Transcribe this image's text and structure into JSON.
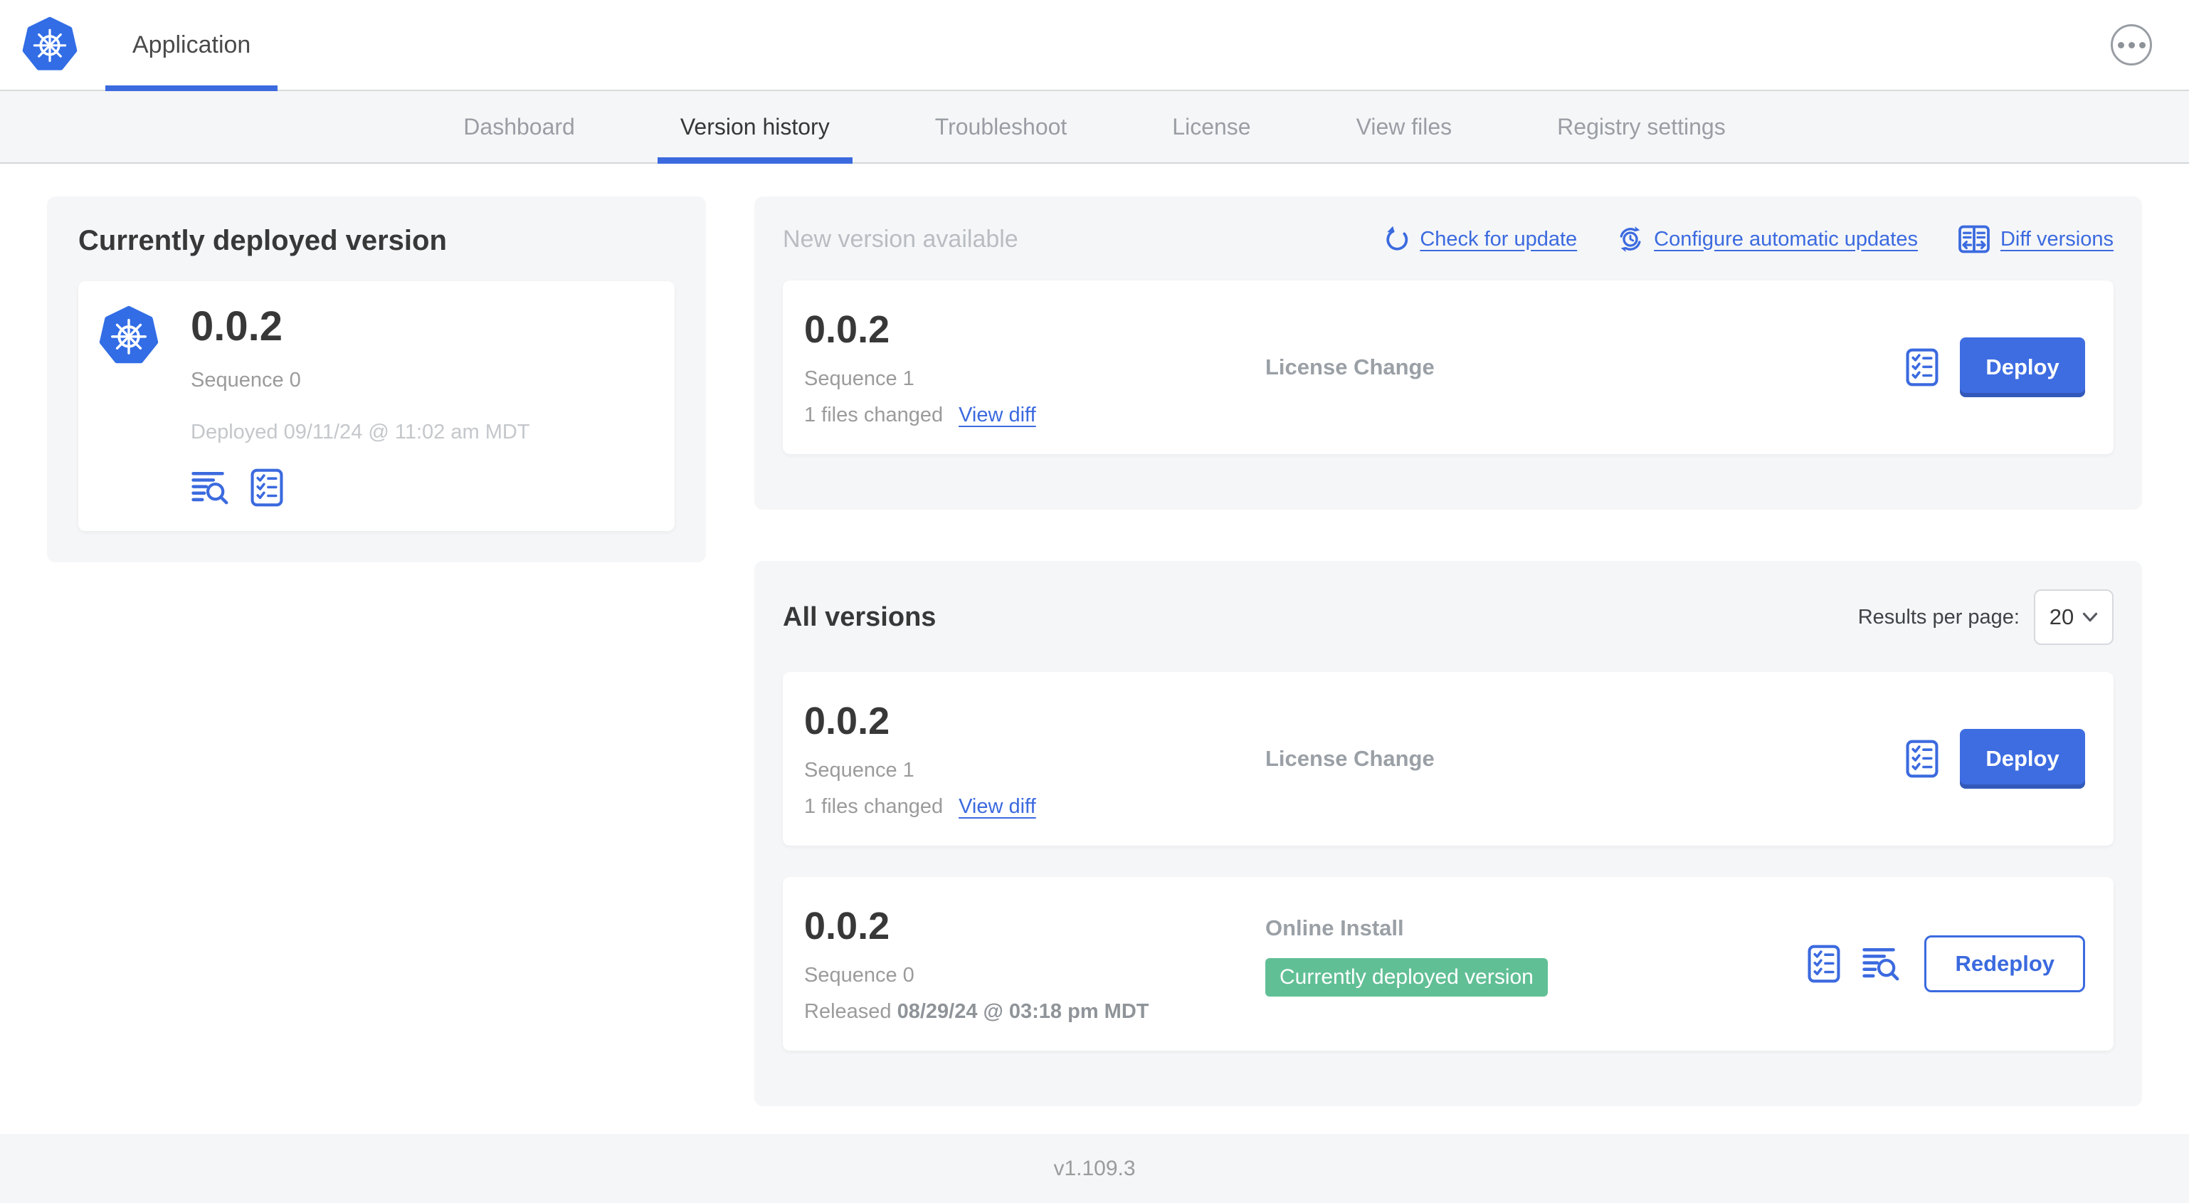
{
  "header": {
    "title": "Application"
  },
  "nav": {
    "tabs": [
      {
        "label": "Dashboard",
        "active": false
      },
      {
        "label": "Version history",
        "active": true
      },
      {
        "label": "Troubleshoot",
        "active": false
      },
      {
        "label": "License",
        "active": false
      },
      {
        "label": "View files",
        "active": false
      },
      {
        "label": "Registry settings",
        "active": false
      }
    ]
  },
  "current_version_panel": {
    "title": "Currently deployed version",
    "version": "0.0.2",
    "sequence": "Sequence 0",
    "deployed": "Deployed 09/11/24 @ 11:02 am MDT"
  },
  "new_version_panel": {
    "title": "New version available",
    "actions": [
      {
        "label": "Check for update",
        "icon": "refresh-ccw-icon"
      },
      {
        "label": "Configure automatic updates",
        "icon": "clock-refresh-icon"
      },
      {
        "label": "Diff versions",
        "icon": "split-diff-icon"
      }
    ],
    "card": {
      "version": "0.0.2",
      "sequence": "Sequence 1",
      "files_changed": "1 files changed",
      "view_diff_label": "View diff",
      "source": "License Change",
      "deploy_label": "Deploy"
    }
  },
  "all_versions_panel": {
    "title": "All versions",
    "results_per_page_label": "Results per page:",
    "results_per_page_value": "20",
    "rows": [
      {
        "version": "0.0.2",
        "sequence": "Sequence 1",
        "files_changed": "1 files changed",
        "view_diff_label": "View diff",
        "source": "License Change",
        "action_label": "Deploy"
      },
      {
        "version": "0.0.2",
        "sequence": "Sequence 0",
        "released_prefix": "Released ",
        "released_date": "08/29/24 @ 03:18 pm MDT",
        "source": "Online Install",
        "badge": "Currently deployed version",
        "action_label": "Redeploy"
      }
    ]
  },
  "footer": {
    "app_version": "v1.109.3"
  },
  "icons": {
    "app_logo": "kubernetes-wheel",
    "more_options": "ellipsis-circle",
    "check_for_update": "refresh-ccw",
    "configure_automatic_updates": "clock-refresh",
    "diff_versions": "split-diff",
    "preflight_checks": "checklist",
    "deploy_logs": "lines-magnifier",
    "results_select": "chevron-down"
  },
  "colors": {
    "kubernetes_blue": "#326de6",
    "link_blue": "#3b6adf",
    "button_blue": "#3e6de2",
    "badge_green": "#61bf95",
    "panel_gray": "#f5f6f8"
  }
}
